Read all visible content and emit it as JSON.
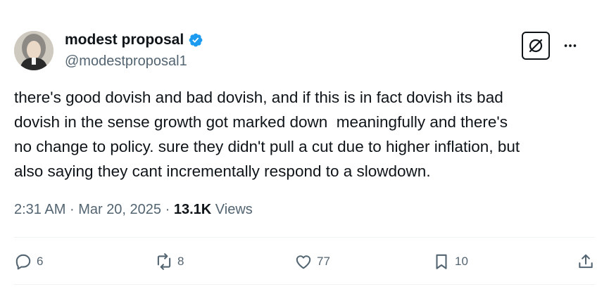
{
  "author": {
    "display_name": "modest proposal",
    "handle": "@modestproposal1",
    "avatar_icon": "portrait-avatar",
    "verified_icon": "verified-badge-icon",
    "verified_color": "#1d9bf0"
  },
  "header": {
    "grok_icon": "grok-icon",
    "more_icon": "more-icon"
  },
  "tweet": {
    "text": "there's good dovish and bad dovish, and if this is in fact dovish its bad\ndovish in the sense growth got marked down  meaningfully and there's\nno change to policy. sure they didn't pull a cut due to higher inflation, but\nalso saying they cant incrementally respond to a slowdown."
  },
  "meta": {
    "time": "2:31 AM",
    "separator": "·",
    "date": "Mar 20, 2025",
    "views_count": "13.1K",
    "views_label": "Views"
  },
  "actions": {
    "replies": "6",
    "reposts": "8",
    "likes": "77",
    "bookmarks": "10"
  },
  "colors": {
    "text": "#0f1419",
    "secondary": "#536471",
    "divider": "#eff3f4"
  }
}
